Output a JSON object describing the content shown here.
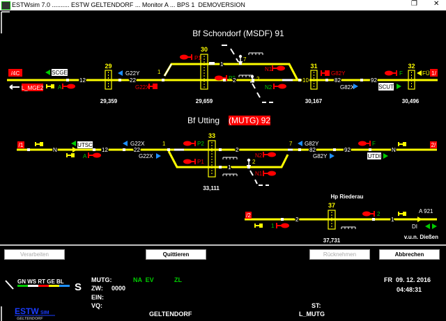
{
  "window": {
    "title": "ESTWsim 7.0 .......... ESTW GELTENDORF ... Monitor A ... BPS 1  DEMOVERSION",
    "restore": "❐",
    "close": "✕"
  },
  "colors": {
    "track": "#ffff00",
    "signal_stop": "#ff0000",
    "signal_go": "#00cc00",
    "direction": "#1e90ff",
    "background": "#000000"
  },
  "schondorf": {
    "title": "Bf Schondorf  (MSDF) 91",
    "left_exit": "/4C",
    "scge": "SCGE",
    "l_mge2": "L_MGE2",
    "sig_a": "A",
    "track_12": "12",
    "block_29": "29",
    "g22y": "G22Y",
    "track_22": "22",
    "g22x": "G22X",
    "switch_1": "1",
    "block_30": "30",
    "p1": "P1",
    "track_1": "1",
    "switch_7": "7",
    "n1": "N1",
    "p2": "P2",
    "switch_2": "2",
    "track_2": "2",
    "n2": "N2",
    "switch_10": "10",
    "block_31": "31",
    "g82y": "G82Y",
    "track_82": "82",
    "g82x": "G82X",
    "track_92": "92",
    "scut": "SCUT",
    "sig_f": "F",
    "block_32": "32",
    "fu": "FÜ",
    "right_exit": "1/",
    "km": [
      "29,359",
      "29,659",
      "30,167",
      "30,496"
    ]
  },
  "utting": {
    "title": "Bf Utting",
    "code": "(MUTG) 92",
    "left_exit": "/1",
    "n_left": "N",
    "utsc": "UTSC",
    "sig_a": "A",
    "track_12": "12",
    "g22x_top": "G22X",
    "track_22": "22",
    "g22x_bottom": "G22X",
    "switch_1": "1",
    "p2": "P2",
    "block_33": "33",
    "track_2": "2",
    "p1": "P1",
    "track_1": "1",
    "switch_2": "2",
    "n2": "N2",
    "n1": "N1",
    "switch_7": "7",
    "g82y_top": "G82Y",
    "track_82": "82",
    "track_92": "92",
    "g82y_bottom": "G82Y",
    "sig_f": "F",
    "utdi": "UTDI",
    "n_right": "N",
    "right_exit": "2/",
    "km": "33,111"
  },
  "riederau": {
    "title": "Hp Riederau",
    "left_exit": "/2",
    "sig_1": "1",
    "track_2": "2",
    "block_37": "37",
    "sig_2": "2",
    "track_1": "1",
    "a921": "A 921",
    "di": "DI",
    "destination": "v.u.n. Dießen",
    "km": "37,731"
  },
  "buttons": {
    "verarbeiten": "Verarbeiten",
    "quittieren": "Quittieren",
    "ruecknehmen": "Rücknehmen",
    "abbrechen": "Abbrechen"
  },
  "legend": {
    "labels": "GN WS RT GE BL",
    "mode": "S",
    "colors": [
      "#00cc00",
      "#ffffff",
      "#ff0000",
      "#ffff00",
      "#1e90ff"
    ]
  },
  "status": {
    "mutg_label": "MUTG:",
    "na_ev": "NA  EV",
    "zl": "ZL",
    "zw_label": "ZW:",
    "zw_value": "0000",
    "ein_label": "EIN:",
    "vq_label": "VQ:",
    "st_label": "ST:",
    "station": "GELTENDORF",
    "st_value": "L_MUTG",
    "date": "FR  09. 12. 2016",
    "time": "04:48:31"
  },
  "logo": {
    "name": "ESTW",
    "suffix": "SIM",
    "sub": "GELTENDORF"
  }
}
